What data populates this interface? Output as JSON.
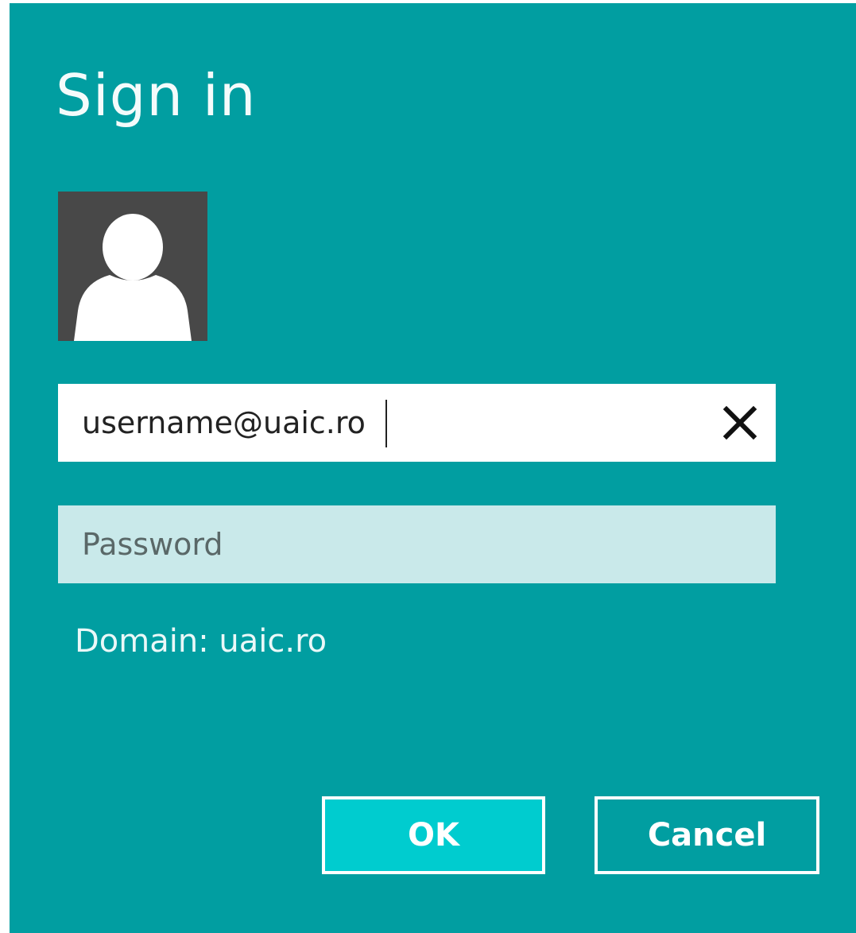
{
  "dialog": {
    "title": "Sign in",
    "avatar_icon": "user-silhouette-icon",
    "username": {
      "value": "username@uaic.ro",
      "clear_icon": "close-icon"
    },
    "password": {
      "placeholder": "Password"
    },
    "domain_text": "Domain: uaic.ro",
    "buttons": {
      "ok_label": "OK",
      "cancel_label": "Cancel"
    }
  },
  "colors": {
    "background": "#019ea1",
    "ok_button": "#00cccf",
    "password_field": "#c9e9ea",
    "avatar_bg": "#484848"
  }
}
